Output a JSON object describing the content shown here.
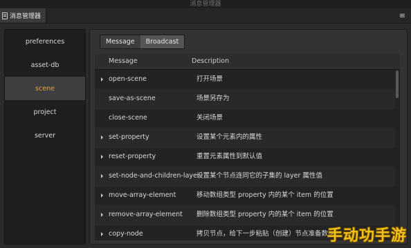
{
  "window": {
    "title": "消息管理器"
  },
  "panel": {
    "tab_label": "消息管理器",
    "menu_icon": "hamburger-menu-icon"
  },
  "sidebar": {
    "items": [
      {
        "label": "preferences",
        "active": false
      },
      {
        "label": "asset-db",
        "active": false
      },
      {
        "label": "scene",
        "active": true
      },
      {
        "label": "project",
        "active": false
      },
      {
        "label": "server",
        "active": false
      }
    ]
  },
  "tabs": [
    {
      "label": "Message",
      "active": false
    },
    {
      "label": "Broadcast",
      "active": true
    }
  ],
  "table": {
    "columns": [
      "Message",
      "Description"
    ],
    "rows": [
      {
        "expandable": true,
        "message": "open-scene",
        "description": "打开场景"
      },
      {
        "expandable": false,
        "message": "save-as-scene",
        "description": "场景另存为"
      },
      {
        "expandable": false,
        "message": "close-scene",
        "description": "关闭场景"
      },
      {
        "expandable": true,
        "message": "set-property",
        "description": "设置某个元素内的属性"
      },
      {
        "expandable": true,
        "message": "reset-property",
        "description": "重置元素属性到默认值"
      },
      {
        "expandable": true,
        "message": "set-node-and-children-layer",
        "description": "设置某个节点连同它的子集的 layer 属性值"
      },
      {
        "expandable": true,
        "message": "move-array-element",
        "description": "移动数组类型 property 内的某个 item 的位置"
      },
      {
        "expandable": true,
        "message": "remove-array-element",
        "description": "删除数组类型 property 内的某个 item 的位置"
      },
      {
        "expandable": true,
        "message": "copy-node",
        "description": "拷贝节点，给下一步粘贴（创建）节点准备数据"
      }
    ]
  },
  "watermark": {
    "text": "手动功手游"
  },
  "colors": {
    "accent": "#f0a040",
    "background": "#2b2b2b"
  }
}
